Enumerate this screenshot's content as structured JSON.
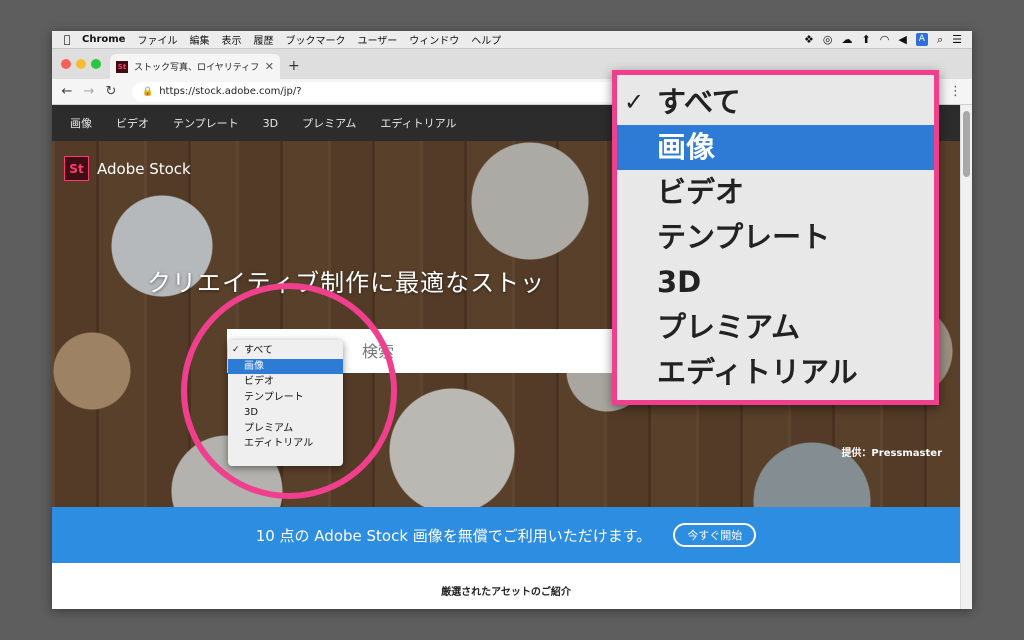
{
  "menubar": {
    "app": "Chrome",
    "items": [
      "ファイル",
      "編集",
      "表示",
      "履歴",
      "ブックマーク",
      "ユーザー",
      "ウィンドウ",
      "ヘルプ"
    ],
    "input_badge": "A"
  },
  "browser": {
    "tab_title": "ストック写真、ロイヤリティフリー",
    "favicon_text": "St",
    "url": "https://stock.adobe.com/jp/?"
  },
  "site_nav": [
    "画像",
    "ビデオ",
    "テンプレート",
    "3D",
    "プレミアム",
    "エディトリアル"
  ],
  "hero": {
    "logo_mark": "St",
    "logo_text": "Adobe Stock",
    "headline": "クリエイティブ制作に最適なストッ",
    "search_placeholder": "検索",
    "credit": "提供：Pressmaster"
  },
  "dropdown": {
    "check_mark": "✓",
    "options": [
      "すべて",
      "画像",
      "ビデオ",
      "テンプレート",
      "3D",
      "プレミアム",
      "エディトリアル"
    ],
    "checked_option": "すべて",
    "highlighted_option": "画像"
  },
  "banner": {
    "text": "10 点の Adobe Stock 画像を無償でご利用いただけます。",
    "cta": "今すぐ開始"
  },
  "section_title": "厳選されたアセットのご紹介",
  "colors": {
    "accent_pink": "#f03f8c",
    "select_blue": "#2e7bd6",
    "banner_blue": "#2d8de0",
    "nav_dark": "#2c2c2c"
  }
}
